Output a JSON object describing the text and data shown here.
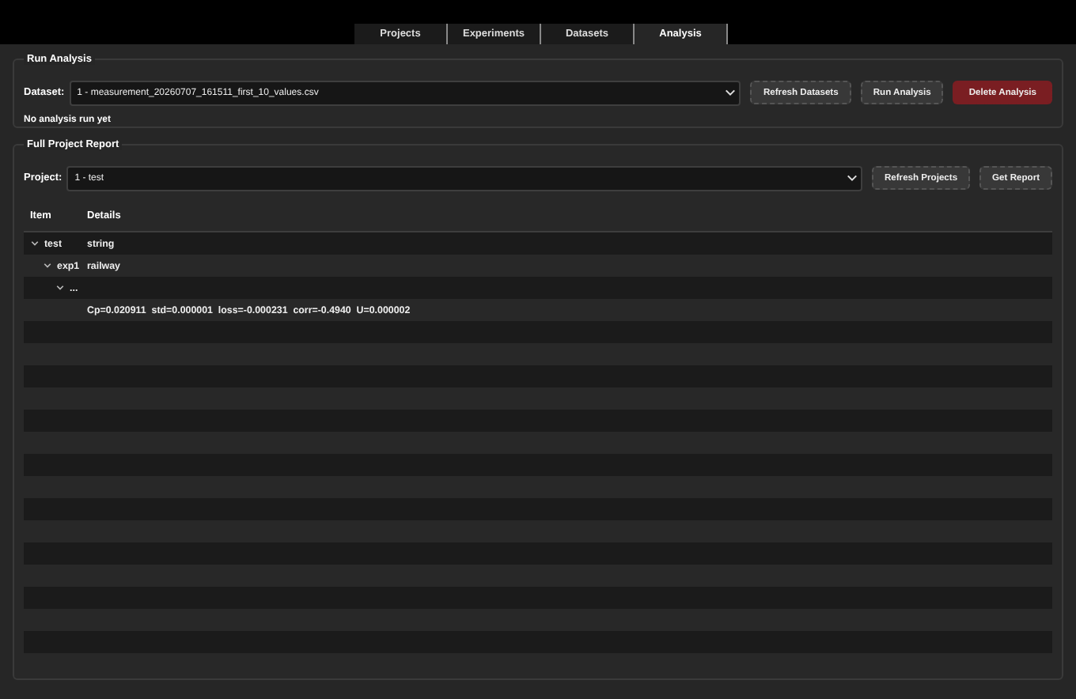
{
  "tabs": [
    {
      "label": "Projects",
      "selected": false
    },
    {
      "label": "Experiments",
      "selected": false
    },
    {
      "label": "Datasets",
      "selected": false
    },
    {
      "label": "Analysis",
      "selected": true
    }
  ],
  "run_analysis": {
    "title": "Run Analysis",
    "dataset_label": "Dataset:",
    "dataset_value": "1 - measurement_20260707_161511_first_10_values.csv",
    "buttons": [
      {
        "label": "Refresh Datasets",
        "kind": "normal"
      },
      {
        "label": "Run Analysis",
        "kind": "normal"
      },
      {
        "label": "Delete Analysis",
        "kind": "danger"
      }
    ],
    "status": "No analysis run yet"
  },
  "report": {
    "title": "Full Project Report",
    "project_label": "Project:",
    "project_value": "1 - test",
    "buttons": [
      {
        "label": "Refresh Projects",
        "kind": "normal"
      },
      {
        "label": "Get Report",
        "kind": "normal"
      }
    ],
    "tree": {
      "columns": [
        "Item",
        "Details"
      ],
      "rows": [
        {
          "item": "test",
          "details": "string",
          "expanded": true,
          "children": [
            {
              "item": "exp1",
              "details": "railway",
              "expanded": true,
              "children": [
                {
                  "item": "...",
                  "expanded": true,
                  "children": [
                    {
                      "details": "Cp=0.020911  std=0.000001  loss=-0.000231  corr=-0.4940  U=0.000002"
                    }
                  ]
                }
              ]
            }
          ]
        }
      ]
    }
  }
}
